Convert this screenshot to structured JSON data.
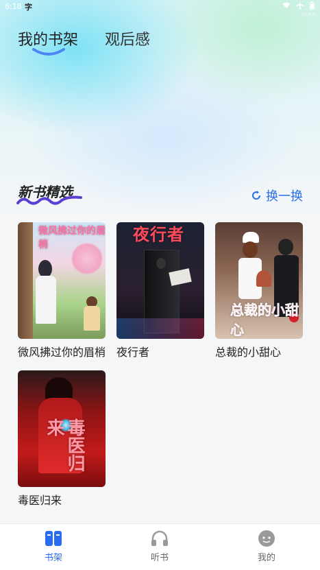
{
  "status_bar": {
    "time": "6:18",
    "ime": "字",
    "badge": "NEXUS"
  },
  "top_tabs": [
    {
      "label": "我的书架",
      "active": true
    },
    {
      "label": "观后感",
      "active": false
    }
  ],
  "section": {
    "title": "新书精选",
    "refresh_label": "换一换"
  },
  "books": [
    {
      "title": "微风拂过你的眉梢",
      "cover_text": "微风拂过你的眉梢"
    },
    {
      "title": "夜行者",
      "cover_text": "夜行者"
    },
    {
      "title": "总裁的小甜心",
      "cover_text": "总裁的小甜心"
    },
    {
      "title": "毒医归来",
      "cover_text": "毒医归来"
    }
  ],
  "bottom_nav": [
    {
      "label": "书架",
      "icon": "bookshelf-icon",
      "active": true
    },
    {
      "label": "听书",
      "icon": "headphones-icon",
      "active": false
    },
    {
      "label": "我的",
      "icon": "profile-chat-icon",
      "active": false
    }
  ],
  "colors": {
    "accent": "#2a6cf0",
    "underline": "#4a86f5"
  }
}
